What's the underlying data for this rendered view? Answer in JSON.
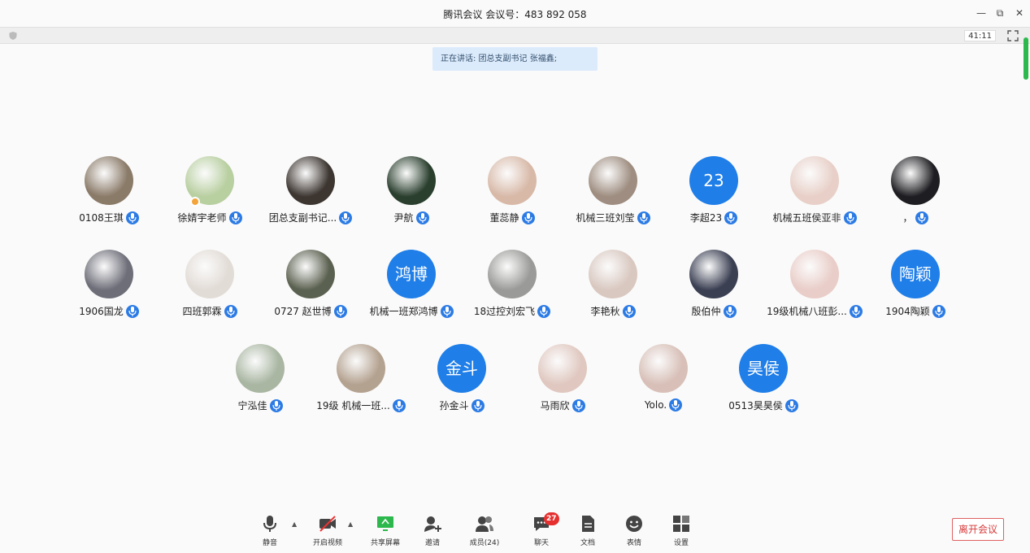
{
  "window": {
    "title": "腾讯会议 会议号：483 892 058"
  },
  "infobar": {
    "timer": "41:11"
  },
  "speaking": "正在讲话: 团总支副书记  张福鑫;",
  "participants": [
    {
      "name": "0108王琪",
      "avatar": "photo",
      "color": "#8a7a68"
    },
    {
      "name": "徐婧宇老师",
      "avatar": "photo",
      "color": "#b8cfa0",
      "badge": true
    },
    {
      "name": "团总支副书记...",
      "avatar": "photo",
      "color": "#3c3530",
      "mic": "active"
    },
    {
      "name": "尹航",
      "avatar": "photo",
      "color": "#2a3f2e"
    },
    {
      "name": "董蕊静",
      "avatar": "photo",
      "color": "#d8b9a8"
    },
    {
      "name": "机械三班刘莹",
      "avatar": "photo",
      "color": "#9e8d80"
    },
    {
      "name": "李超23",
      "avatar": "text",
      "text": "23"
    },
    {
      "name": "机械五班侯亚非",
      "avatar": "photo",
      "color": "#e8d0c8"
    },
    {
      "name": "，",
      "avatar": "photo",
      "color": "#1e1e22"
    },
    {
      "name": "1906国龙",
      "avatar": "photo",
      "color": "#6d6e78"
    },
    {
      "name": "四班郭霖",
      "avatar": "photo",
      "color": "#e2dcd6"
    },
    {
      "name": "0727 赵世博",
      "avatar": "photo",
      "color": "#5b6150"
    },
    {
      "name": "机械一班郑鸿博",
      "avatar": "text",
      "text": "鸿博"
    },
    {
      "name": "18过控刘宏飞",
      "avatar": "photo",
      "color": "#9a9a98"
    },
    {
      "name": "李艳秋",
      "avatar": "photo",
      "color": "#d9c8c0"
    },
    {
      "name": "殷伯仲",
      "avatar": "photo",
      "color": "#3a3f52"
    },
    {
      "name": "19级机械八班彭...",
      "avatar": "photo",
      "color": "#e9cdc8"
    },
    {
      "name": "1904陶颖",
      "avatar": "text",
      "text": "陶颖"
    },
    {
      "name": "宁泓佳",
      "avatar": "photo",
      "color": "#a9b6a2"
    },
    {
      "name": "19级 机械一班...",
      "avatar": "photo",
      "color": "#b4a290"
    },
    {
      "name": "孙金斗",
      "avatar": "text",
      "text": "金斗"
    },
    {
      "name": "马雨欣",
      "avatar": "photo",
      "color": "#e0c8c0"
    },
    {
      "name": "Yolo.",
      "avatar": "photo",
      "color": "#d8c0b8"
    },
    {
      "name": "0513昊昊侯",
      "avatar": "text",
      "text": "昊侯"
    }
  ],
  "toolbar": {
    "mute": "静音",
    "video": "开启视频",
    "share": "共享屏幕",
    "invite": "邀请",
    "members": "成员(24)",
    "chat": "聊天",
    "chat_unread": "27",
    "docs": "文档",
    "emoji": "表情",
    "settings": "设置",
    "leave": "离开会议"
  },
  "colors": {
    "accent": "#1f7ee8",
    "share_green": "#2db84d",
    "leave_red": "#d63a3a"
  }
}
